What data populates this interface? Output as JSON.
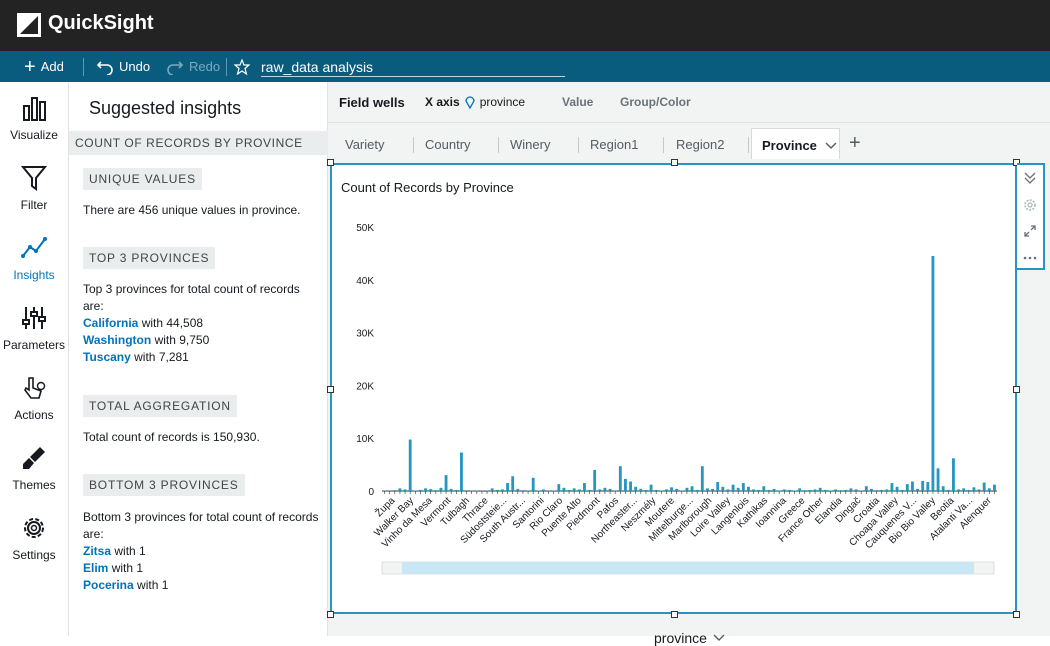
{
  "app": {
    "name": "QuickSight"
  },
  "toolbar": {
    "add": "Add",
    "undo": "Undo",
    "redo": "Redo",
    "analysis_name": "raw_data analysis"
  },
  "nav": {
    "visualize": "Visualize",
    "filter": "Filter",
    "insights": "Insights",
    "parameters": "Parameters",
    "actions": "Actions",
    "themes": "Themes",
    "settings": "Settings"
  },
  "panel": {
    "title": "Suggested insights",
    "subtitle": "COUNT OF RECORDS BY PROVINCE",
    "unique_head": "UNIQUE VALUES",
    "unique_text": "There are 456 unique values in province.",
    "top3_head": "TOP 3 PROVINCES",
    "top3_intro": "Top 3 provinces for total count of records are:",
    "top3": [
      {
        "name": "California",
        "value": "with 44,508"
      },
      {
        "name": "Washington",
        "value": "with 9,750"
      },
      {
        "name": "Tuscany",
        "value": "with 7,281"
      }
    ],
    "agg_head": "TOTAL AGGREGATION",
    "agg_text": "Total count of records is 150,930.",
    "bottom3_head": "BOTTOM 3 PROVINCES",
    "bottom3_intro": "Bottom 3 provinces for total count of records are:",
    "bottom3": [
      {
        "name": "Zitsa",
        "value": "with 1"
      },
      {
        "name": "Elim",
        "value": "with 1"
      },
      {
        "name": "Pocerina",
        "value": "with 1"
      }
    ]
  },
  "fieldwells": {
    "label": "Field wells",
    "xaxis_label": "X axis",
    "xaxis_field": "province",
    "value": "Value",
    "group": "Group/Color"
  },
  "tabs": [
    "Variety",
    "Country",
    "Winery",
    "Region1",
    "Region2",
    "Province"
  ],
  "active_tab": "Province",
  "visual": {
    "title": "Count of Records by Province",
    "x_field": "province"
  },
  "colors": {
    "accent": "#0073bb",
    "bar": "#2496c1",
    "toolbar": "#0a5c7f"
  },
  "chart_data": {
    "type": "bar",
    "title": "Count of Records by Province",
    "xlabel": "province",
    "ylabel": "",
    "ylim": [
      0,
      50000
    ],
    "yticks": [
      "0",
      "10K",
      "20K",
      "30K",
      "40K",
      "50K"
    ],
    "tick_labels": [
      "Župa",
      "Walker Bay",
      "Vinho da Mesa",
      "Vermont",
      "Tulbagh",
      "Thrace",
      "Südoststeie...",
      "South Austr...",
      "Santorini",
      "Rio Claro",
      "Puente Alto",
      "Piedmont",
      "Pafos",
      "Northeaster...",
      "Neszmély",
      "Moutere",
      "Mittelburge...",
      "Marlborough",
      "Loire Valley",
      "Langenlois",
      "Kathikas",
      "Ioannina",
      "Greece",
      "France Other",
      "Elandia",
      "Dingač",
      "Croatia",
      "Choapa Valley",
      "Cauquenes V...",
      "Bio Bio Valley",
      "Beotia",
      "Atalanti Va...",
      "Alenquer"
    ],
    "values": [
      80,
      60,
      150,
      500,
      300,
      9750,
      100,
      200,
      500,
      350,
      150,
      600,
      3000,
      400,
      200,
      7281,
      150,
      80,
      100,
      60,
      80,
      500,
      200,
      300,
      1500,
      2800,
      400,
      150,
      100,
      2500,
      100,
      300,
      100,
      80,
      1300,
      600,
      200,
      500,
      300,
      1500,
      200,
      4000,
      300,
      600,
      400,
      80,
      4700,
      2300,
      1800,
      800,
      400,
      200,
      1200,
      200,
      100,
      300,
      700,
      400,
      100,
      600,
      900,
      200,
      4700,
      500,
      400,
      1700,
      800,
      300,
      1200,
      600,
      1500,
      800,
      300,
      200,
      900,
      200,
      400,
      100,
      300,
      200,
      100,
      500,
      150,
      200,
      300,
      600,
      200,
      100,
      300,
      150,
      200,
      500,
      300,
      100,
      900,
      400,
      150,
      200,
      300,
      1500,
      800,
      200,
      1300,
      1800,
      400,
      1900,
      1700,
      44508,
      4300,
      900,
      200,
      6200,
      300,
      500,
      200,
      700,
      300,
      1600,
      500,
      1200
    ]
  }
}
